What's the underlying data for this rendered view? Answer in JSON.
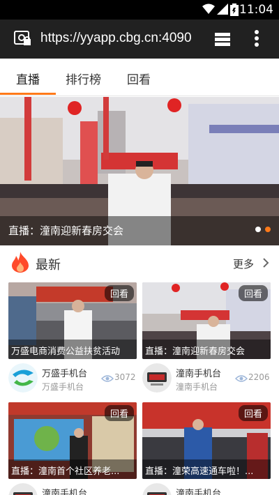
{
  "status_bar": {
    "time": "11:04",
    "icons": [
      "wifi-icon",
      "signal-icon",
      "battery-icon"
    ]
  },
  "browser": {
    "url": "https://yyapp.cbg.cn:4090",
    "site_icon": "site-info-icon",
    "tabs_icon": "tabs-icon",
    "menu_icon": "overflow-menu-icon"
  },
  "tabs": [
    {
      "label": "直播",
      "active": true
    },
    {
      "label": "排行榜",
      "active": false
    },
    {
      "label": "回看",
      "active": false
    }
  ],
  "banner": {
    "caption": "直播：潼南迎新春房交会",
    "dots": 2,
    "active_dot": 1
  },
  "latest": {
    "title": "最新",
    "more": "更多"
  },
  "cards": [
    {
      "badge": "回看",
      "title": "万盛电商消费公益扶贫活动",
      "channel": "万盛手机台",
      "sub": "万盛手机台",
      "views": "3072"
    },
    {
      "badge": "回看",
      "title": "直播：潼南迎新春房交会",
      "channel": "潼南手机台",
      "sub": "潼南手机台",
      "views": "2206"
    },
    {
      "badge": "回看",
      "title": "直播：潼南首个社区养老...",
      "channel": "潼南手机台",
      "sub": "",
      "views": ""
    },
    {
      "badge": "回看",
      "title": "直播：潼荣高速通车啦！...",
      "channel": "潼南手机台",
      "sub": "",
      "views": ""
    }
  ],
  "colors": {
    "accent": "#ff7a1a",
    "statusbar": "#000000",
    "urlbar": "#212121"
  }
}
